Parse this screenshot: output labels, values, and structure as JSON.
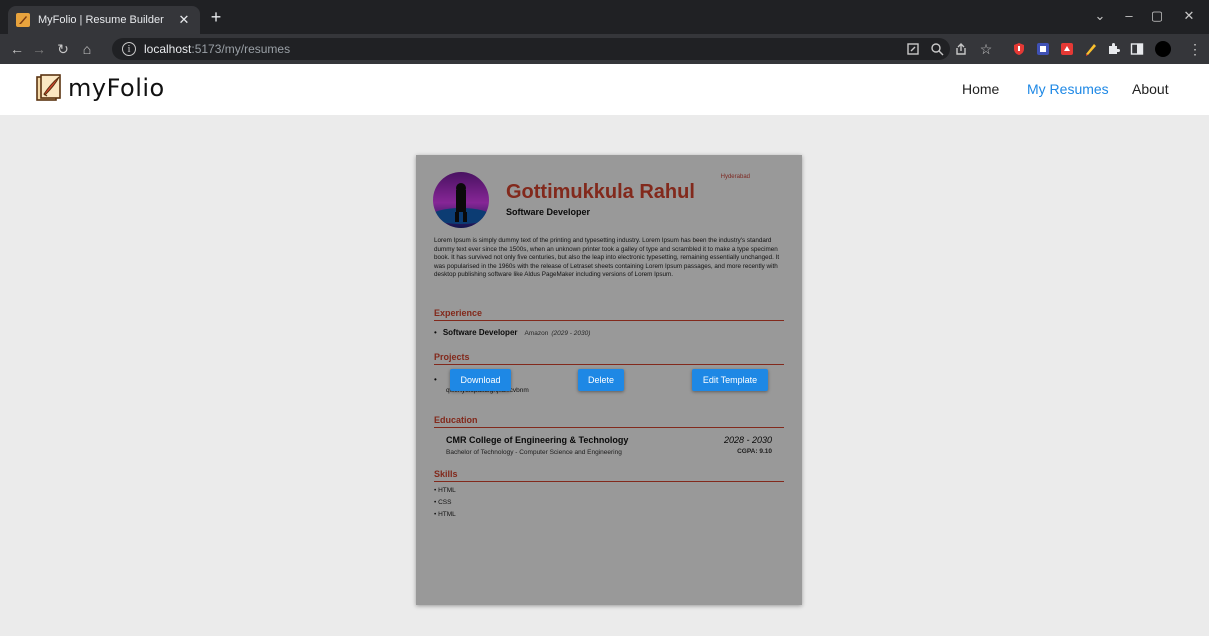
{
  "browser": {
    "tab_title": "MyFolio | Resume Builder",
    "url_host": "localhost",
    "url_path": ":5173/my/resumes"
  },
  "nav": {
    "logo_text": "myFolio",
    "links": [
      "Home",
      "My Resumes",
      "About"
    ],
    "active": "My Resumes"
  },
  "resume": {
    "location": "Hyderabad",
    "name": "Gottimukkula Rahul",
    "role": "Software Developer",
    "summary": "Lorem Ipsum is simply dummy text of the printing and typesetting industry. Lorem Ipsum has been the industry's standard dummy text ever since the 1500s, when an unknown printer took a galley of type and scrambled it to make a type specimen book. It has survived not only five centuries, but also the leap into electronic typesetting, remaining essentially unchanged. It was popularised in the 1960s with the release of Letraset sheets containing Lorem Ipsum passages, and more recently with desktop publishing software like Aldus PageMaker including versions of Lorem Ipsum.",
    "sections": {
      "experience": "Experience",
      "projects": "Projects",
      "education": "Education",
      "skills": "Skills"
    },
    "experience": [
      {
        "title": "Software Developer",
        "company": "Amazon",
        "dates": "(2029 - 2030)"
      }
    ],
    "project_text": "qwertyuiopasdfghjklzxcvbnm",
    "education": {
      "institution": "CMR College of Engineering & Technology",
      "dates": "2028 - 2030",
      "degree": "Bachelor of Technology - Computer Science and Engineering",
      "gpa": "CGPA: 9.10"
    },
    "skills": [
      "HTML",
      "CSS",
      "HTML"
    ]
  },
  "actions": {
    "download": "Download",
    "delete": "Delete",
    "edit": "Edit Template"
  },
  "colors": {
    "accent": "#1e88e5",
    "resume_accent": "#d9452f",
    "page_bg": "#ebebeb"
  }
}
